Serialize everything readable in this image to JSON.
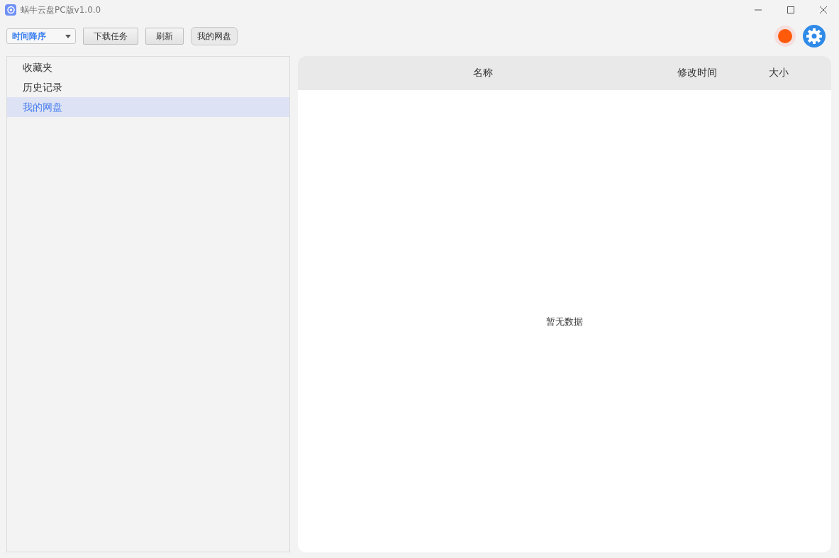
{
  "window": {
    "title": "蜗牛云盘PC版v1.0.0"
  },
  "toolbar": {
    "sort": {
      "value": "时间降序"
    },
    "buttons": [
      "下载任务",
      "刷新"
    ],
    "breadcrumb": [
      "我的网盘"
    ]
  },
  "sidebar": {
    "items": [
      {
        "label": "收藏夹",
        "selected": false
      },
      {
        "label": "历史记录",
        "selected": false
      },
      {
        "label": "我的网盘",
        "selected": true
      }
    ]
  },
  "table": {
    "columns": [
      "名称",
      "修改时间",
      "大小"
    ],
    "empty_text": "暂无数据"
  }
}
